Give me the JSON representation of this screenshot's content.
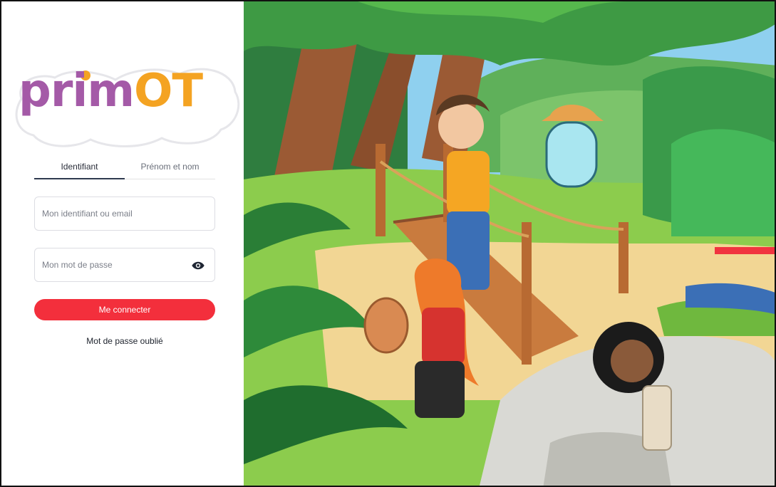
{
  "logo": {
    "text_part1": "prim",
    "text_part2": "OT"
  },
  "tabs": [
    {
      "label": "Identifiant",
      "active": true
    },
    {
      "label": "Prénom et nom",
      "active": false
    }
  ],
  "form": {
    "identifier_placeholder": "Mon identifiant ou email",
    "password_placeholder": "Mon mot de passe"
  },
  "actions": {
    "login_label": "Me connecter",
    "forgot_label": "Mot de passe oublié"
  },
  "icons": {
    "password_toggle": "eye-icon"
  },
  "colors": {
    "primary_button": "#f32f3c",
    "logo_purple": "#a45aa7",
    "logo_orange": "#f4a322",
    "tab_underline": "#2f3a4e"
  }
}
